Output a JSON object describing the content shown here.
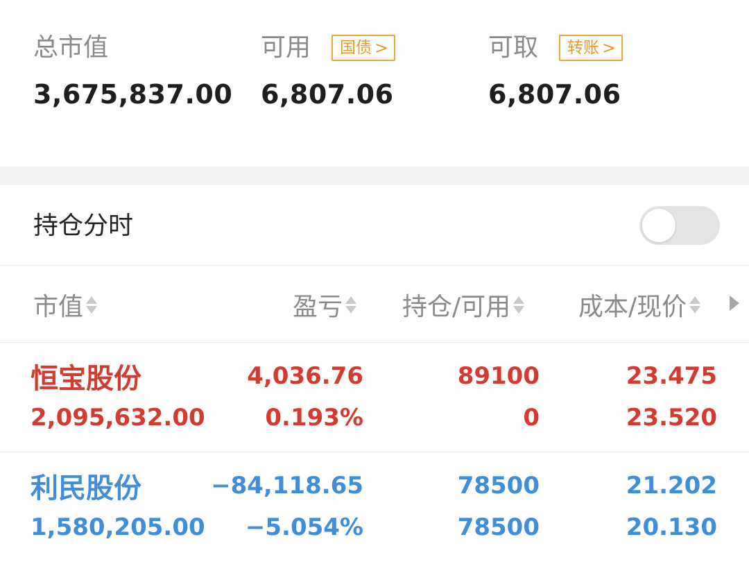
{
  "summary": {
    "total_market_value": {
      "label": "总市值",
      "value": "3,675,837.00"
    },
    "available": {
      "label": "可用",
      "tag": "国债",
      "value": "6,807.06"
    },
    "withdrawable": {
      "label": "可取",
      "tag": "转账",
      "value": "6,807.06"
    }
  },
  "position_timeshare": {
    "label": "持仓分时",
    "toggle_on": false
  },
  "table": {
    "headers": [
      "市值",
      "盈亏",
      "持仓/可用",
      "成本/现价"
    ],
    "rows": [
      {
        "name": "恒宝股份",
        "market_value": "2,095,632.00",
        "pnl": "4,036.76",
        "pnl_pct": "0.193%",
        "position": "89100",
        "available": "0",
        "cost": "23.475",
        "price": "23.520",
        "color": "#d13b32"
      },
      {
        "name": "利民股份",
        "market_value": "1,580,205.00",
        "pnl": "−84,118.65",
        "pnl_pct": "−5.054%",
        "position": "78500",
        "available": "78500",
        "cost": "21.202",
        "price": "20.130",
        "color": "#3f8ed7"
      }
    ]
  },
  "colors": {
    "accent_tag": "#e39b2a",
    "gain": "#d13b32",
    "loss": "#3f8ed7"
  },
  "icons": {
    "sort": "sort-icon",
    "more": "chevron-right-icon",
    "tag_chevron": "chevron-right-icon"
  }
}
